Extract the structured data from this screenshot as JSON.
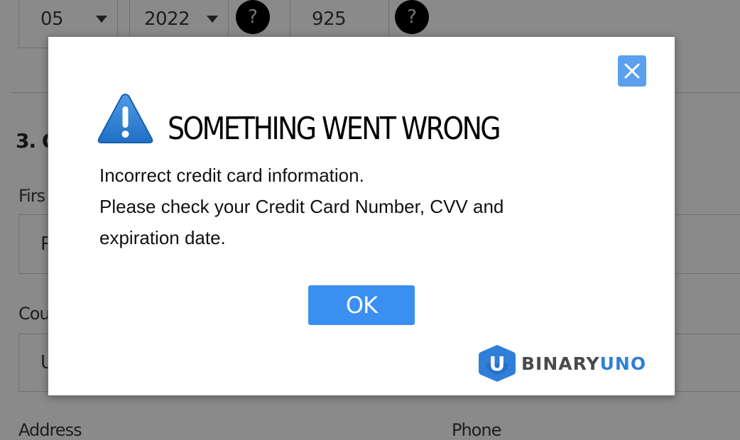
{
  "background_form": {
    "month_value": "05",
    "year_value": "2022",
    "cvv_value": "925",
    "help_glyph": "?",
    "section_heading": "3. C",
    "first_name_label": "Firs",
    "first_name_value": "R",
    "country_label": "Cou",
    "country_value": "U",
    "address_label": "Address",
    "phone_label": "Phone"
  },
  "modal": {
    "title": "SOMETHING WENT WRONG",
    "message_lines": [
      "Incorrect credit card information.",
      "Please check your Credit Card Number, CVV and",
      "expiration date."
    ],
    "ok_label": "OK",
    "close_icon": "close-icon",
    "warning_icon": "warning-triangle-icon",
    "brand": {
      "part1": "BINARY",
      "part2": "UNO",
      "logo_letter": "U"
    }
  },
  "colors": {
    "overlay_bg": "#8a8a8a",
    "accent_blue": "#3b8ff0",
    "close_blue": "#5aa0ee",
    "brand_blue": "#2f7fd8"
  }
}
